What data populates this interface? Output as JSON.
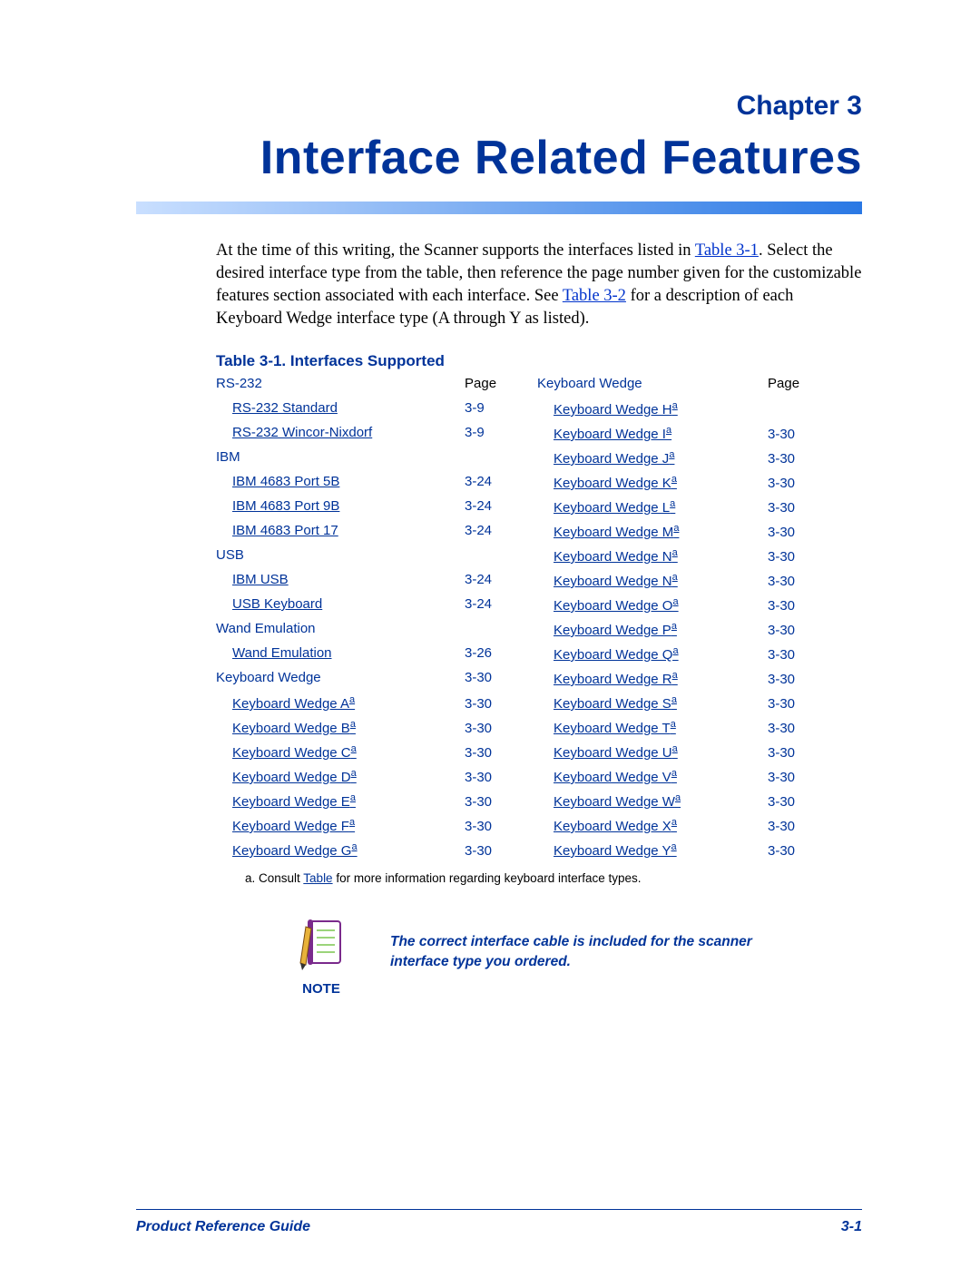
{
  "chapter_label": "Chapter 3",
  "chapter_title": "Interface Related Features",
  "intro_parts": {
    "p1": "At the time of this writing, the Scanner supports the interfaces listed in ",
    "link1": "Table 3-1",
    "p2": ". Select the desired interface type from the table, then reference the page number given for the customizable features section associated with each interface. See ",
    "link2": "Table 3-2",
    "p3": " for a description of each Keyboard Wedge interface type (A through Y as listed)."
  },
  "table_caption": "Table 3-1. Interfaces Supported",
  "page_header_label": "Page",
  "left_column": [
    {
      "type": "group",
      "label": "RS-232"
    },
    {
      "type": "item",
      "label": "RS-232 Standard",
      "page": "3-9"
    },
    {
      "type": "item",
      "label": "RS-232 Wincor-Nixdorf",
      "page": "3-9"
    },
    {
      "type": "group",
      "label": "IBM"
    },
    {
      "type": "item",
      "label": "IBM 4683 Port 5B",
      "page": "3-24"
    },
    {
      "type": "item",
      "label": "IBM 4683 Port 9B",
      "page": "3-24"
    },
    {
      "type": "item",
      "label": "IBM 4683 Port 17",
      "page": "3-24"
    },
    {
      "type": "group",
      "label": "USB"
    },
    {
      "type": "item",
      "label": "IBM USB",
      "page": "3-24"
    },
    {
      "type": "item",
      "label": "USB Keyboard",
      "page": "3-24"
    },
    {
      "type": "group",
      "label": "Wand Emulation"
    },
    {
      "type": "item",
      "label": "Wand Emulation",
      "page": "3-26"
    },
    {
      "type": "grouppage",
      "label": "Keyboard Wedge",
      "page": "3-30"
    },
    {
      "type": "itemfoot",
      "label": "Keyboard Wedge A",
      "page": "3-30"
    },
    {
      "type": "itemfoot",
      "label": "Keyboard Wedge B",
      "page": "3-30"
    },
    {
      "type": "itemfoot",
      "label": "Keyboard Wedge C",
      "page": "3-30"
    },
    {
      "type": "itemfoot",
      "label": "Keyboard Wedge D",
      "page": "3-30"
    },
    {
      "type": "itemfoot",
      "label": "Keyboard Wedge E",
      "page": "3-30"
    },
    {
      "type": "itemfoot",
      "label": "Keyboard Wedge F",
      "page": "3-30"
    },
    {
      "type": "itemfoot",
      "label": "Keyboard Wedge G",
      "page": "3-30"
    }
  ],
  "right_column_header": "Keyboard Wedge",
  "right_column": [
    {
      "label": "Keyboard Wedge H",
      "page": ""
    },
    {
      "label": "Keyboard Wedge I",
      "page": "3-30"
    },
    {
      "label": "Keyboard Wedge J",
      "page": "3-30"
    },
    {
      "label": "Keyboard Wedge K",
      "page": "3-30"
    },
    {
      "label": "Keyboard Wedge L",
      "page": "3-30"
    },
    {
      "label": "Keyboard Wedge M",
      "page": "3-30"
    },
    {
      "label": "Keyboard Wedge N",
      "page": "3-30"
    },
    {
      "label": "Keyboard Wedge N",
      "page": "3-30"
    },
    {
      "label": "Keyboard Wedge O",
      "page": "3-30"
    },
    {
      "label": "Keyboard Wedge P",
      "page": "3-30"
    },
    {
      "label": "Keyboard Wedge Q",
      "page": "3-30"
    },
    {
      "label": "Keyboard Wedge R",
      "page": "3-30"
    },
    {
      "label": "Keyboard Wedge S",
      "page": "3-30"
    },
    {
      "label": "Keyboard Wedge T",
      "page": "3-30"
    },
    {
      "label": "Keyboard Wedge U",
      "page": "3-30"
    },
    {
      "label": "Keyboard Wedge V",
      "page": "3-30"
    },
    {
      "label": "Keyboard Wedge W",
      "page": "3-30"
    },
    {
      "label": "Keyboard Wedge X",
      "page": "3-30"
    },
    {
      "label": "Keyboard Wedge Y",
      "page": "3-30"
    }
  ],
  "footnote_parts": {
    "prefix": "a.  Consult ",
    "link": "Table",
    "suffix": "  for more information regarding keyboard  interface  types."
  },
  "note": {
    "label": "NOTE",
    "text": "The correct interface cable is included for the scanner interface type you ordered."
  },
  "footer": {
    "left": "Product Reference Guide",
    "right": "3-1"
  },
  "sup": "a"
}
